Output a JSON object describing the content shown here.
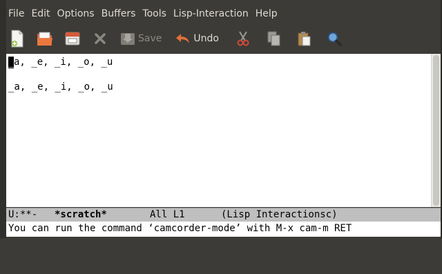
{
  "menubar": {
    "items": [
      "File",
      "Edit",
      "Options",
      "Buffers",
      "Tools",
      "Lisp-Interaction",
      "Help"
    ]
  },
  "toolbar": {
    "tools": [
      {
        "icon": "new-file-icon",
        "label": ""
      },
      {
        "icon": "open-folder-icon",
        "label": ""
      },
      {
        "icon": "save-window-icon",
        "label": ""
      },
      {
        "icon": "close-icon",
        "label": ""
      },
      {
        "icon": "save-icon",
        "label": "Save"
      },
      {
        "icon": "undo-icon",
        "label": "Undo"
      },
      {
        "icon": "cut-icon",
        "label": ""
      },
      {
        "icon": "copy-icon",
        "label": ""
      },
      {
        "icon": "paste-icon",
        "label": ""
      },
      {
        "icon": "search-icon",
        "label": ""
      }
    ],
    "save_label": "Save",
    "undo_label": "Undo"
  },
  "editor": {
    "cursor_char": "_",
    "line1_rest": "a, _e, _i, _o, _u",
    "line2": "_a, _e, _i, _o, _u"
  },
  "modeline": {
    "status": "U:**-",
    "buffer": "*scratch*",
    "position": "All L1",
    "mode": "(Lisp Interactionsc)"
  },
  "echo": {
    "message": "You can run the command ‘camcorder-mode’ with M-x cam-m RET"
  },
  "colors": {
    "menubar_bg": "#3c3b37",
    "menubar_text": "#dfdbd2",
    "modeline_bg": "#bfbfbf",
    "editor_bg": "#ffffff"
  }
}
